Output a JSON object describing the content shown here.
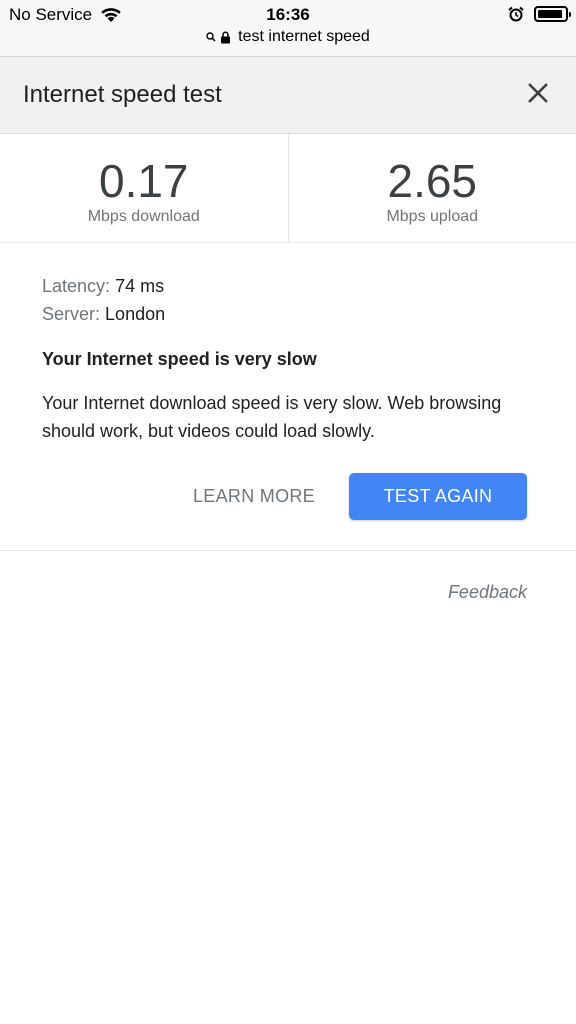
{
  "status_bar": {
    "carrier": "No Service",
    "time": "16:36",
    "url": "test internet speed"
  },
  "header": {
    "title": "Internet speed test"
  },
  "speeds": {
    "download_value": "0.17",
    "download_unit": "Mbps download",
    "upload_value": "2.65",
    "upload_unit": "Mbps upload"
  },
  "details": {
    "latency_label": "Latency:",
    "latency_value": "74 ms",
    "server_label": "Server:",
    "server_value": "London",
    "headline": "Your Internet speed is very slow",
    "description": "Your Internet download speed is very slow. Web browsing should work, but videos could load slowly."
  },
  "actions": {
    "learn_more": "LEARN MORE",
    "test_again": "TEST AGAIN"
  },
  "feedback": "Feedback",
  "colors": {
    "accent": "#4285f4",
    "secondary_text": "#70757a"
  },
  "icons": [
    "wifi-icon",
    "alarm-icon",
    "battery-icon",
    "search-icon",
    "lock-icon",
    "close-icon"
  ]
}
